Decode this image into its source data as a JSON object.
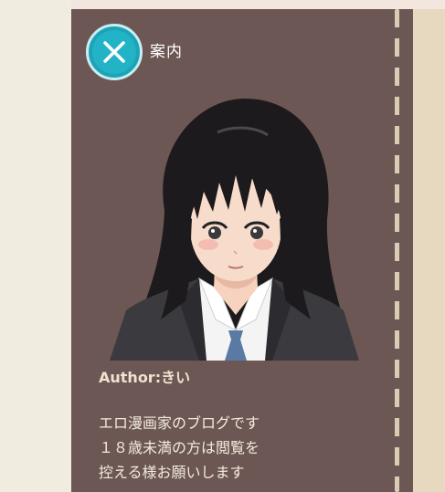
{
  "nav": {
    "title": "案内",
    "close_icon": "close-icon"
  },
  "profile": {
    "avatar_icon": "avatar-illustration",
    "author": "Author:きい",
    "description_lines": [
      "エロ漫画家のブログです",
      "１８歳未満の方は閲覧を",
      "控える様お願いします"
    ]
  },
  "colors": {
    "page_bg": "#f1ece0",
    "panel_bg": "#6d5754",
    "right_bg": "#e6d9bf",
    "accent": "#1ea3b6",
    "dash": "#d6cdb3",
    "text": "#f2ebde"
  }
}
